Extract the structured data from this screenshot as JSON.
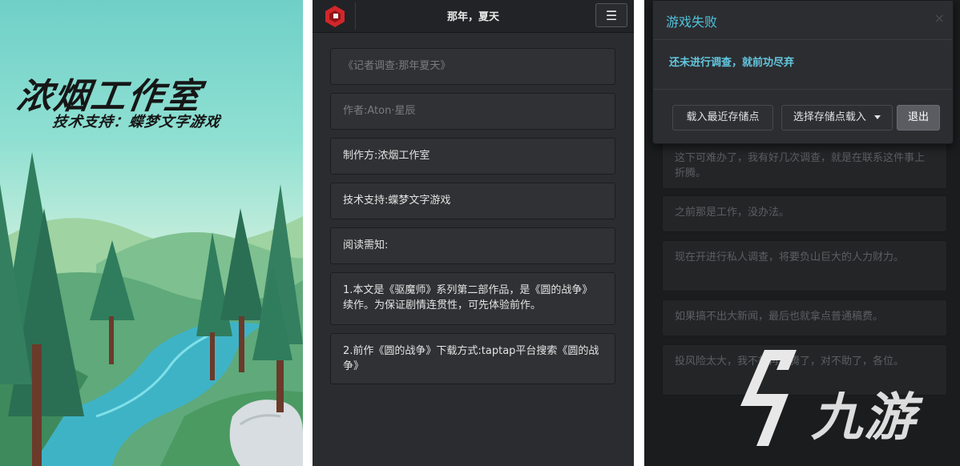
{
  "splash": {
    "title": "浓烟工作室",
    "subtitle": "技术支持：蝶梦文字游戏"
  },
  "reader": {
    "header_title": "那年，夏天",
    "menu_icon": "☰",
    "cards": [
      "《记者调查:那年夏天》",
      "作者:Aton·星辰",
      "制作方:浓烟工作室",
      "技术支持:蝶梦文字游戏",
      "阅读需知:",
      "1.本文是《驱魔师》系列第二部作品，是《圆的战争》续作。为保证剧情连贯性，可先体验前作。",
      "2.前作《圆的战争》下载方式:taptap平台搜索《圆的战争》"
    ]
  },
  "game_over": {
    "dialog_title": "游戏失败",
    "close_symbol": "×",
    "message": "还未进行调查，就前功尽弃",
    "buttons": {
      "load_recent": "载入最近存储点",
      "choose_save": "选择存储点载入",
      "exit": "退出"
    },
    "story_cards": [
      "这下可难办了，我有好几次调查，就是在联系这件事上折腾。",
      "之前那是工作，没办法。",
      "现在开进行私人调查，将要负山巨大的人力财力。",
      "如果搞不出大新闻，最后也就拿点普通稿费。",
      "投风险太大，我不想再折腾了，对不助了，各位。"
    ],
    "watermark_text": "九游"
  },
  "colors": {
    "accent_cyan": "#4fc3dd",
    "logo_red": "#d3262b"
  }
}
